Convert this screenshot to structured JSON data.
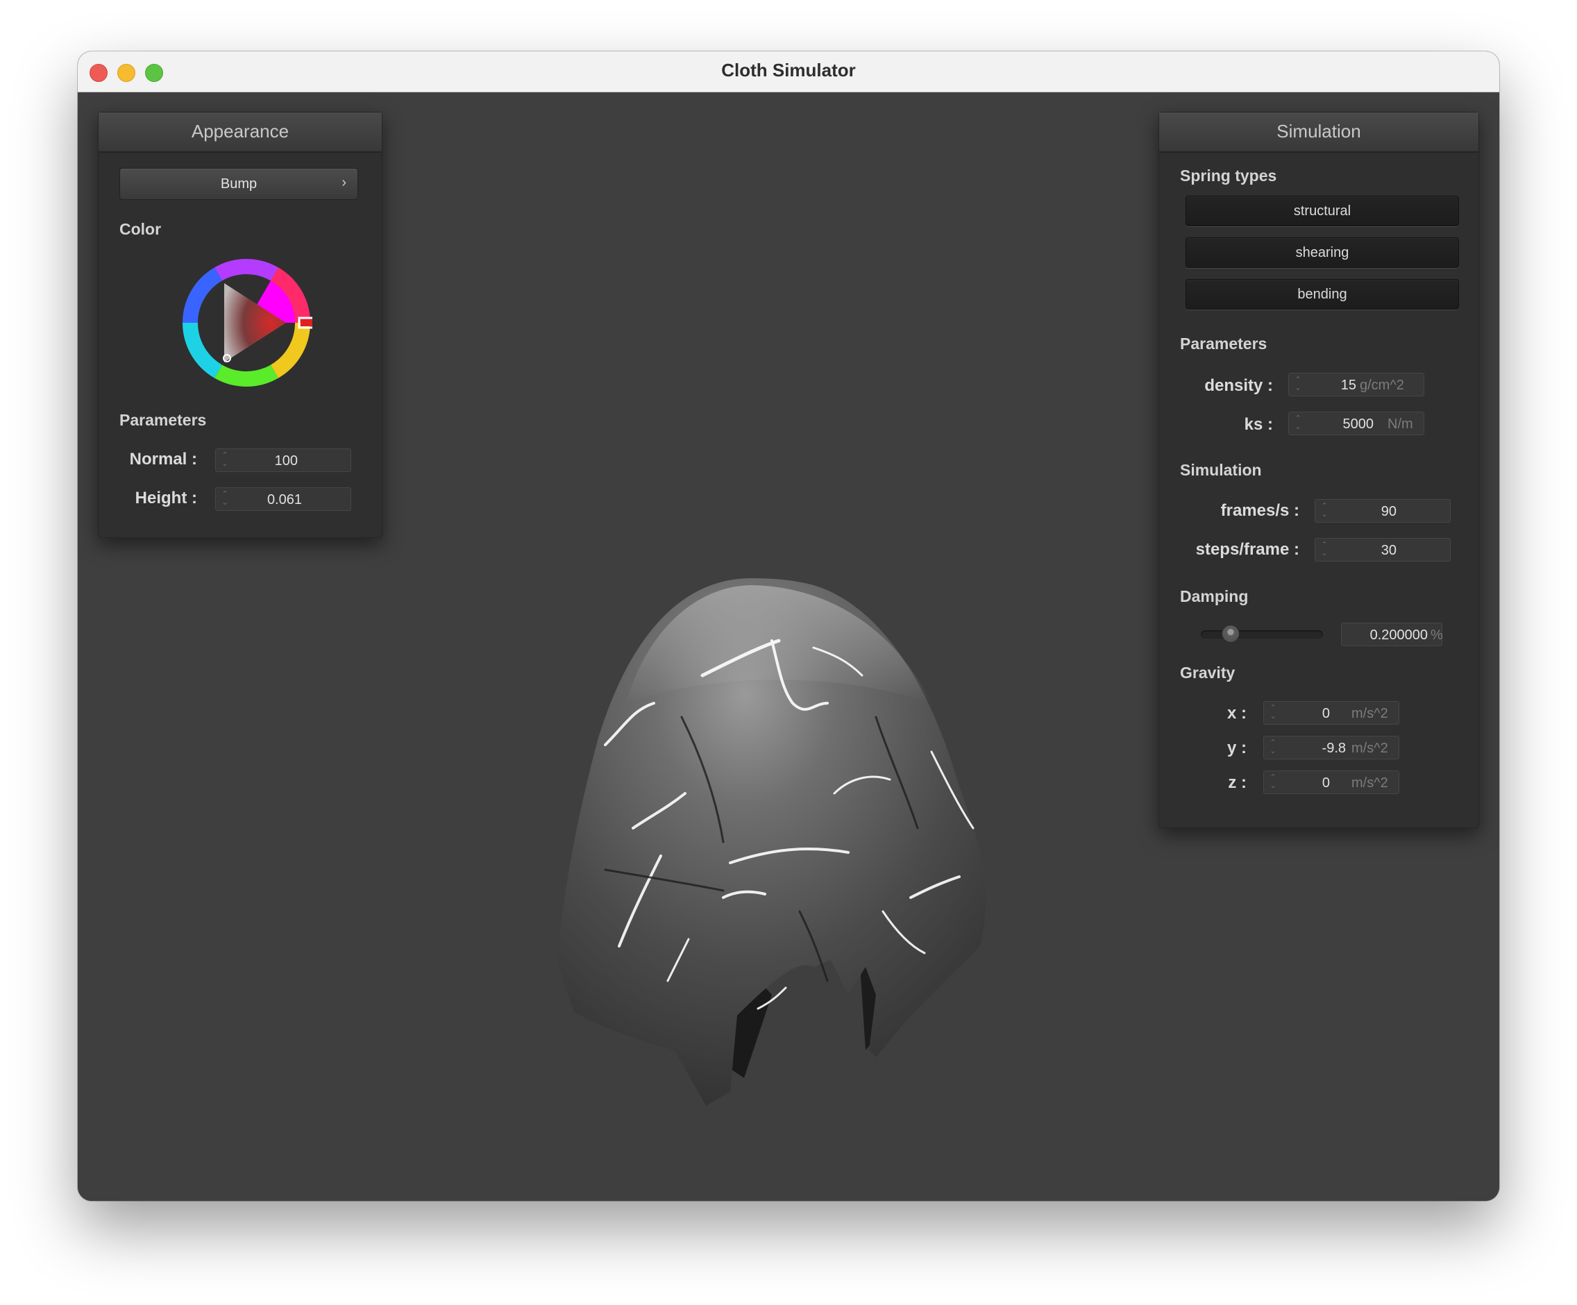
{
  "window": {
    "title": "Cloth Simulator"
  },
  "appearance": {
    "header": "Appearance",
    "shader_button": "Bump",
    "color_section": "Color",
    "parameters_section": "Parameters",
    "normal": {
      "label": "Normal :",
      "value": "100"
    },
    "height": {
      "label": "Height :",
      "value": "0.061"
    },
    "color_hex": "#e02020"
  },
  "simulation": {
    "header": "Simulation",
    "spring_types_section": "Spring types",
    "spring_types": [
      "structural",
      "shearing",
      "bending"
    ],
    "parameters_section": "Parameters",
    "density": {
      "label": "density :",
      "value": "15",
      "unit": "g/cm^2"
    },
    "ks": {
      "label": "ks :",
      "value": "5000",
      "unit": "N/m"
    },
    "simulation_section": "Simulation",
    "frames_per_s": {
      "label": "frames/s :",
      "value": "90"
    },
    "steps_per_frame": {
      "label": "steps/frame :",
      "value": "30"
    },
    "damping_section": "Damping",
    "damping": {
      "value": "0.200000",
      "unit": "%",
      "slider_fraction": 0.2
    },
    "gravity_section": "Gravity",
    "gravity": {
      "x": {
        "label": "x :",
        "value": "0",
        "unit": "m/s^2"
      },
      "y": {
        "label": "y :",
        "value": "-9.8",
        "unit": "m/s^2"
      },
      "z": {
        "label": "z :",
        "value": "0",
        "unit": "m/s^2"
      }
    }
  },
  "colors": {
    "viewport_bg": "#3f3f3f",
    "panel_bg": "#2f2f2f",
    "close": "#ee5b55",
    "minimize": "#f6bb2e",
    "maximize": "#5bc543"
  },
  "icons": {
    "popup_chevron": "chevron-right-icon",
    "spinner": "stepper-arrows-icon"
  }
}
